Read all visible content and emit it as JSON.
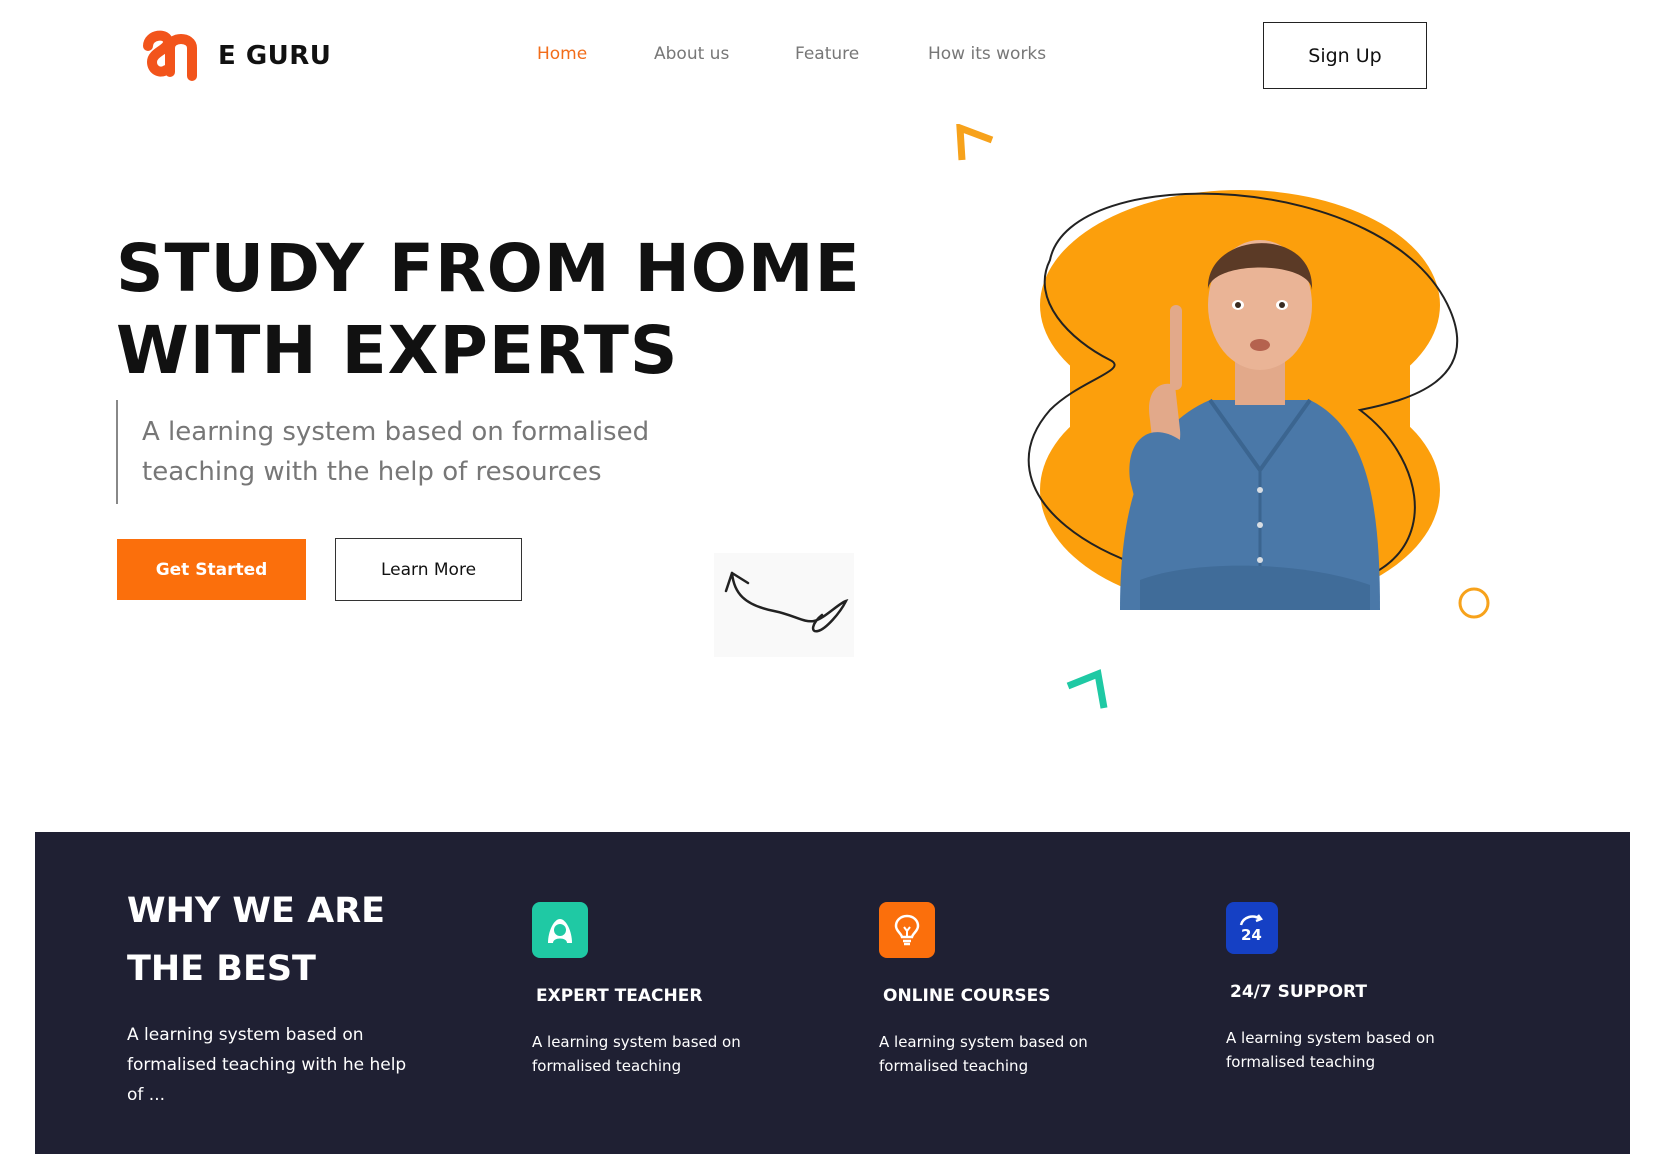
{
  "brand": {
    "name": "E GURU"
  },
  "nav": {
    "items": [
      {
        "label": "Home",
        "active": true
      },
      {
        "label": "About us",
        "active": false
      },
      {
        "label": "Feature",
        "active": false
      },
      {
        "label": "How its works",
        "active": false
      }
    ],
    "signup_label": "Sign Up"
  },
  "hero": {
    "title_line1": "STUDY FROM HOME",
    "title_line2": "WITH EXPERTS",
    "subtitle": "A learning system based on formalised teaching with the help of resources",
    "primary_label": "Get Started",
    "secondary_label": "Learn More"
  },
  "why": {
    "title_line1": "WHY WE ARE",
    "title_line2": "THE BEST",
    "description": "A learning system based on formalised teaching with he help of ...",
    "features": [
      {
        "icon": "teacher-icon",
        "color": "#1fc9a4",
        "title": "EXPERT TEACHER",
        "description": "A learning system based on formalised teaching"
      },
      {
        "icon": "lightbulb-icon",
        "color": "#fb6f0c",
        "title": "ONLINE COURSES",
        "description": "A learning system based on formalised teaching"
      },
      {
        "icon": "support-24-icon",
        "color": "#1540c4",
        "title": "24/7 SUPPORT",
        "description": "A learning system based on formalised teaching"
      }
    ]
  },
  "colors": {
    "accent": "#fb6f0c",
    "hero_blob": "#fc9f0c",
    "teal": "#1fc9a4",
    "dark_bg": "#1f2033"
  }
}
